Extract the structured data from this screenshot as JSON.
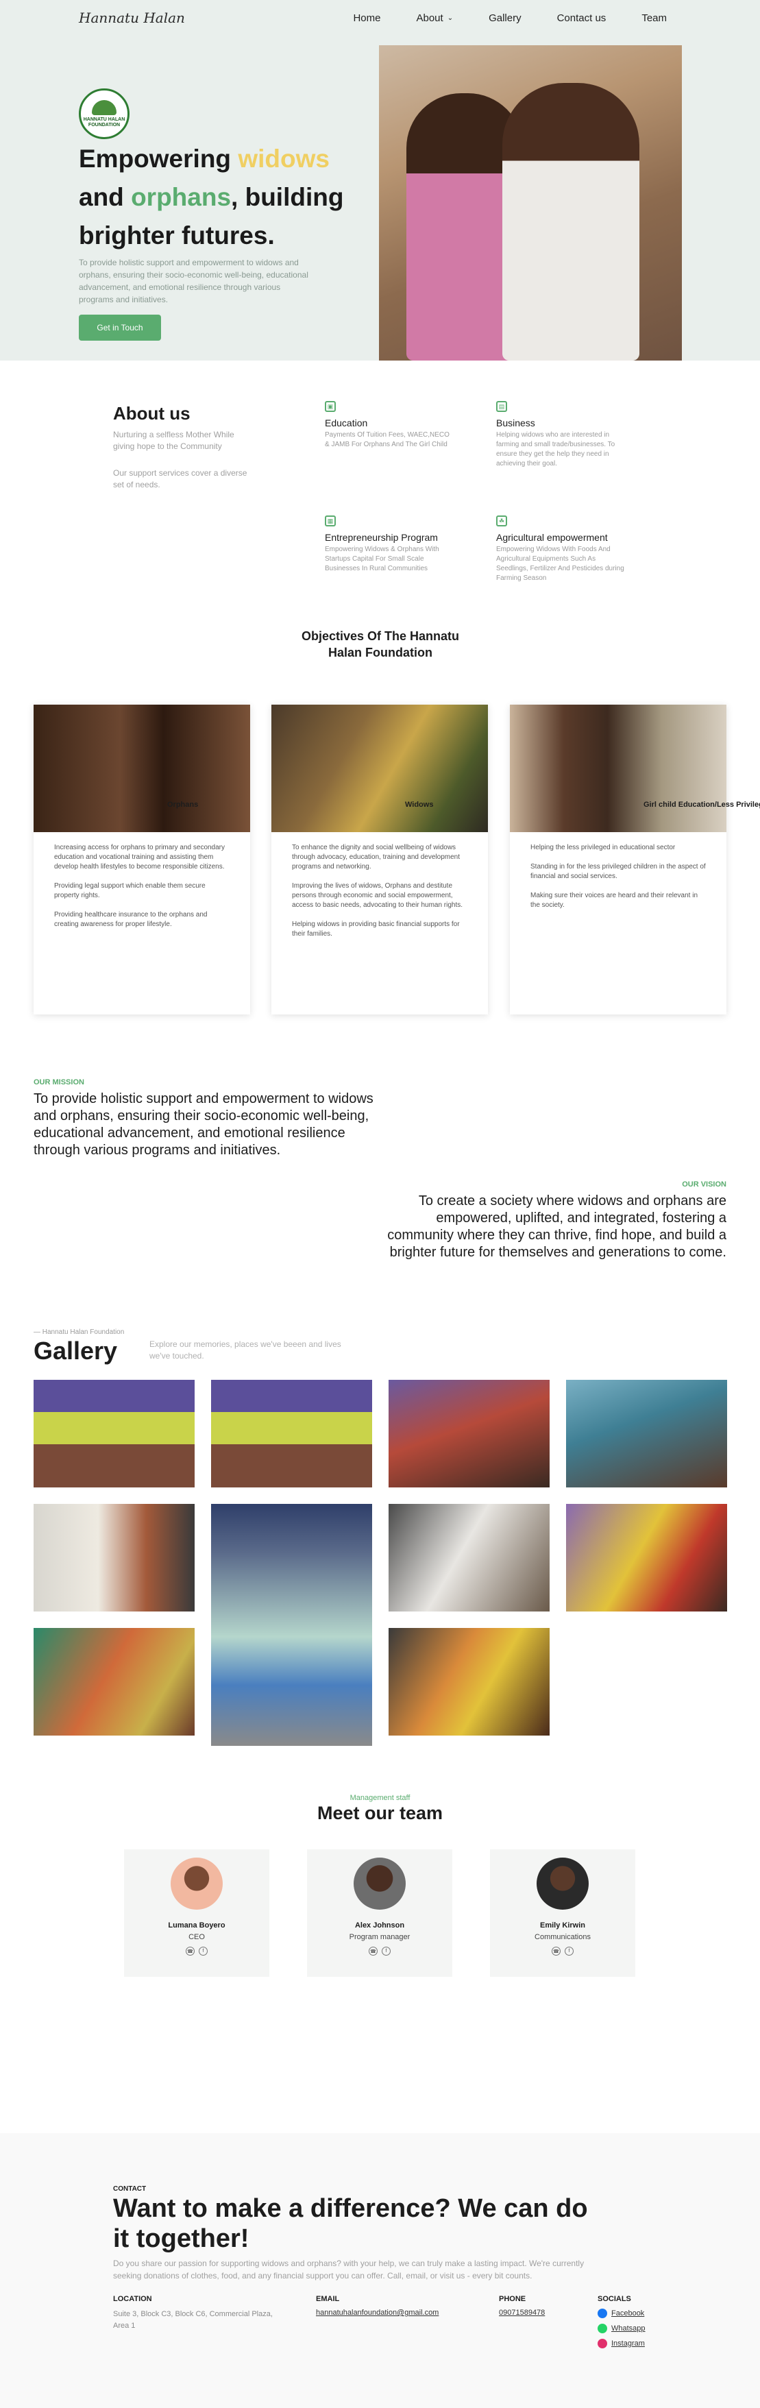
{
  "nav": {
    "brand": "Hannatu Halan",
    "links": [
      {
        "label": "Home"
      },
      {
        "label": "About"
      },
      {
        "label": "Gallery"
      },
      {
        "label": "Contact us"
      },
      {
        "label": "Team"
      }
    ]
  },
  "hero": {
    "logo_text": "HANNATU HALAN FOUNDATION",
    "title_part1": "Empowering ",
    "title_highlight1": "widows",
    "title_part2": "and ",
    "title_highlight2": "orphans",
    "title_part3": ", building",
    "title_part4": "brighter futures.",
    "description": "To provide holistic support and empowerment to widows and orphans, ensuring their socio-economic well-being, educational advancement, and emotional resilience through various programs and initiatives.",
    "cta": "Get in Touch"
  },
  "about": {
    "title": "About us",
    "subtitle": "Nurturing a selfless Mother While giving hope to the Community",
    "subtitle2": "Our support services cover a diverse set of needs.",
    "services": [
      {
        "title": "Education",
        "desc": "Payments Of Tuition Fees, WAEC,NECO & JAMB For Orphans And The Girl Child"
      },
      {
        "title": "Business",
        "desc": "Helping widows who are interested in farming and small trade/businesses. To ensure they get the help they need in achieving their goal."
      },
      {
        "title": "Entrepreneurship Program",
        "desc": "Empowering Widows & Orphans With Startups Capital For Small Scale Businesses In Rural Communities"
      },
      {
        "title": "Agricultural empowerment",
        "desc": "Empowering Widows With Foods And Agricultural Equipments Such As Seedlings, Fertilizer And Pesticides during Farming Season"
      }
    ]
  },
  "objectives": {
    "title": "Objectives Of The Hannatu Halan Foundation",
    "cards": [
      {
        "title": "Orphans",
        "paragraphs": [
          "Increasing access for orphans to primary and secondary education and vocational training and assisting them develop health lifestyles to become responsible citizens.",
          "Providing legal support which enable them secure property rights.",
          "Providing healthcare insurance to the orphans and creating awareness for proper lifestyle."
        ]
      },
      {
        "title": "Widows",
        "paragraphs": [
          "To enhance the dignity and social wellbeing of widows through advocacy, education, training and development programs and networking.",
          "Improving the lives of widows, Orphans and destitute persons through economic and social empowerment, access to basic needs, advocating to their human rights.",
          "Helping widows in providing basic financial supports for their families."
        ]
      },
      {
        "title": "Girl child Education/Less Privileged",
        "paragraphs": [
          "Helping the less privileged in educational sector",
          "Standing in for the less privileged children in the aspect of financial and social services.",
          "Making sure their voices are heard and their relevant in the society."
        ]
      }
    ]
  },
  "mission": {
    "tag": "OUR MISSION",
    "text": "To provide holistic support and empowerment to widows and orphans, ensuring their socio-economic well-being, educational advancement, and emotional resilience through various programs and initiatives."
  },
  "vision": {
    "tag": "OUR VISION",
    "text": "To create a society where widows and orphans are empowered, uplifted, and integrated, fostering a community where they can thrive, find hope, and build a brighter future for themselves and generations to come."
  },
  "gallery": {
    "crumb": "— Hannatu Halan Foundation",
    "title": "Gallery",
    "subtitle": "Explore our memories, places we've beeen and lives we've touched."
  },
  "team": {
    "tag": "Management staff",
    "title": "Meet our team",
    "members": [
      {
        "name": "Lumana Boyero",
        "role": "CEO"
      },
      {
        "name": "Alex Johnson",
        "role": "Program manager"
      },
      {
        "name": "Emily Kirwin",
        "role": "Communications"
      }
    ]
  },
  "contact": {
    "tag": "CONTACT",
    "title": "Want to make a difference? We can do it together!",
    "description": "Do you share our passion for supporting widows and orphans? with your help, we can truly make a lasting impact. We're currently seeking donations of clothes, food, and any financial support you can offer. Call, email, or visit us - every bit counts.",
    "location_head": "LOCATION",
    "location": "Suite 3, Block C3, Block C6, Commercial Plaza, Area 1",
    "email_head": "EMAIL",
    "email": "hannatuhalanfoundation@gmail.com",
    "phone_head": "PHONE",
    "phone": "09071589478",
    "socials_head": "SOCIALS",
    "socials": [
      {
        "label": "Facebook"
      },
      {
        "label": "Whatsapp"
      },
      {
        "label": "Instagram"
      }
    ]
  },
  "colors": {
    "accent": "#5aac6f",
    "highlight_yellow": "#f0cf62",
    "hero_bg": "#e9efec"
  }
}
